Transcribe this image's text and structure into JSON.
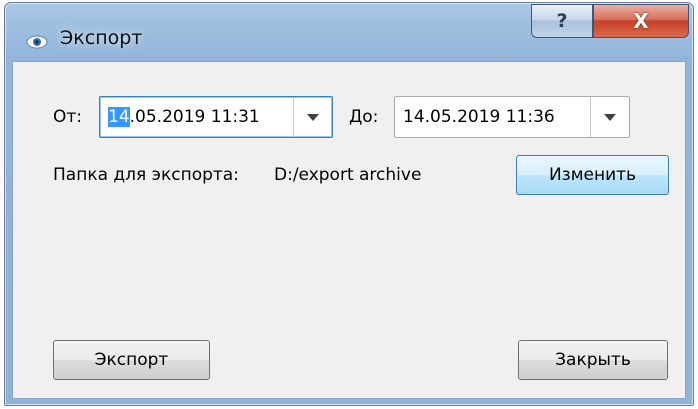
{
  "window": {
    "title": "Экспорт",
    "help_glyph": "?",
    "close_glyph": "X"
  },
  "form": {
    "from_label": "От:",
    "from_value_selected": "14",
    "from_value_rest": ".05.2019 11:31",
    "to_label": "До:",
    "to_value": "14.05.2019 11:36",
    "folder_label": "Папка для экспорта:",
    "folder_path": "D:/export archive",
    "change_button": "Изменить"
  },
  "footer": {
    "export_button": "Экспорт",
    "close_button": "Закрыть"
  },
  "colors": {
    "selection": "#3399ff",
    "client_bg": "#f0f0f0",
    "close_red": "#c8412a"
  },
  "icons": [
    "app-eye-icon",
    "question-icon",
    "close-x-icon",
    "dropdown-arrow-icon"
  ]
}
